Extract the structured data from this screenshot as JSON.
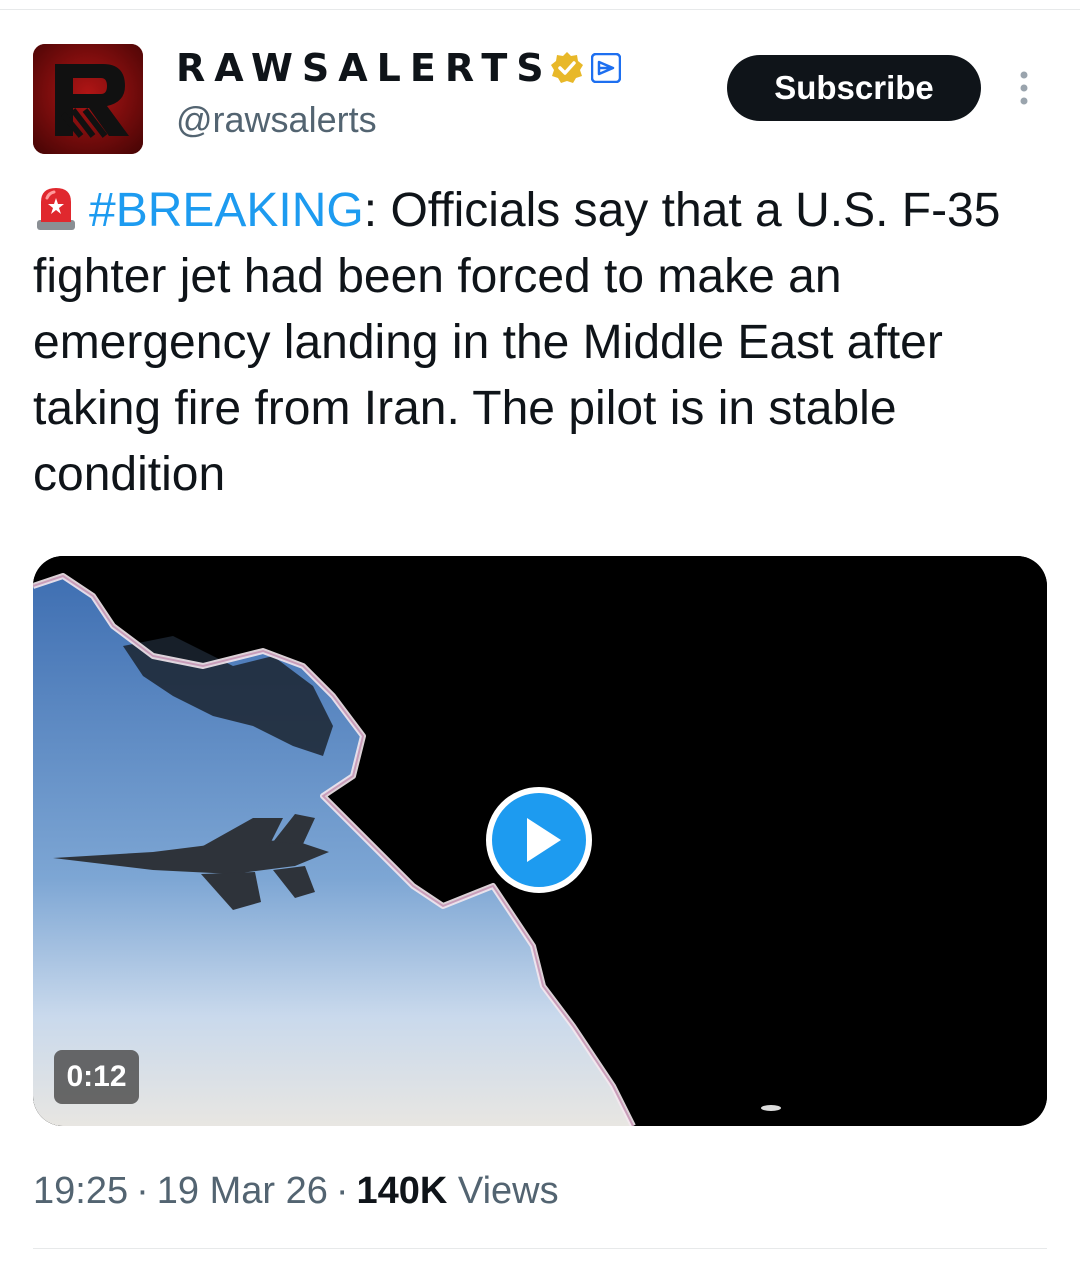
{
  "account": {
    "display_name": "RAWSALERTS",
    "handle": "@rawsalerts",
    "avatar_icon": "raws-logo-icon",
    "verified_icon": "gold-verified-badge-icon",
    "affiliation_icon": "affiliate-badge-icon"
  },
  "actions": {
    "subscribe_label": "Subscribe",
    "more_icon": "more-vertical-icon"
  },
  "tweet": {
    "emoji_icon": "rotating-light-icon",
    "hashtag": "#BREAKING",
    "text": ": Officials say that a U.S. F-35 fighter jet had been forced to make an emergency landing in the Middle East after taking fire from Iran. The pilot is in stable condition"
  },
  "media": {
    "type": "video",
    "play_icon": "play-icon",
    "duration": "0:12"
  },
  "meta": {
    "time": "19:25",
    "date": "19 Mar 26",
    "views_count": "140K",
    "views_label": "Views"
  },
  "colors": {
    "link": "#1d9bf0",
    "text": "#0f1419",
    "secondary": "#536471",
    "button_bg": "#0f1419",
    "verified_gold": "#e8b829"
  }
}
